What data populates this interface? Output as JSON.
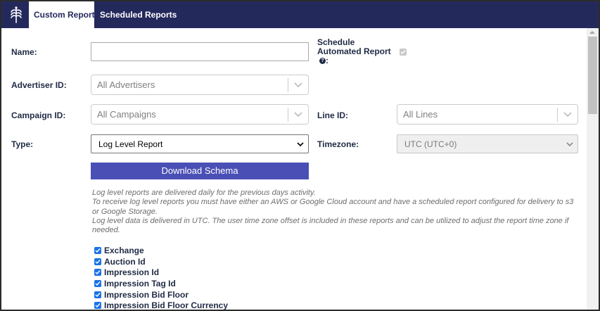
{
  "tabs": [
    {
      "label": "Custom Report",
      "active": true
    },
    {
      "label": "Scheduled Reports",
      "active": false
    }
  ],
  "form": {
    "name_label": "Name:",
    "name_value": "",
    "schedule_label_line1": "Schedule",
    "schedule_label_line2": "Automated Report",
    "schedule_label_line3": ":",
    "schedule_checked": true,
    "advertiser_label": "Advertiser ID:",
    "advertiser_value": "All Advertisers",
    "campaign_label": "Campaign ID:",
    "campaign_value": "All Campaigns",
    "line_label": "Line ID:",
    "line_value": "All Lines",
    "type_label": "Type:",
    "type_value": "Log Level Report",
    "timezone_label": "Timezone:",
    "timezone_value": "UTC (UTC+0)",
    "download_button": "Download Schema"
  },
  "info": [
    "Log level reports are delivered daily for the previous days activity.",
    "To receive log level reports you must have either an AWS or Google Cloud account and have a scheduled report configured for delivery to s3 or Google Storage.",
    "Log level data is delivered in UTC. The user time zone offset is included in these reports and can be utilized to adjust the report time zone if needed."
  ],
  "columns": [
    {
      "label": "Exchange",
      "checked": true
    },
    {
      "label": "Auction Id",
      "checked": true
    },
    {
      "label": "Impression Id",
      "checked": true
    },
    {
      "label": "Impression Tag Id",
      "checked": true
    },
    {
      "label": "Impression Bid Floor",
      "checked": true
    },
    {
      "label": "Impression Bid Floor Currency",
      "checked": true
    }
  ],
  "colors": {
    "header_bg": "#24295c",
    "button_bg": "#4a4fb5",
    "checkbox": "#1a73e8"
  }
}
